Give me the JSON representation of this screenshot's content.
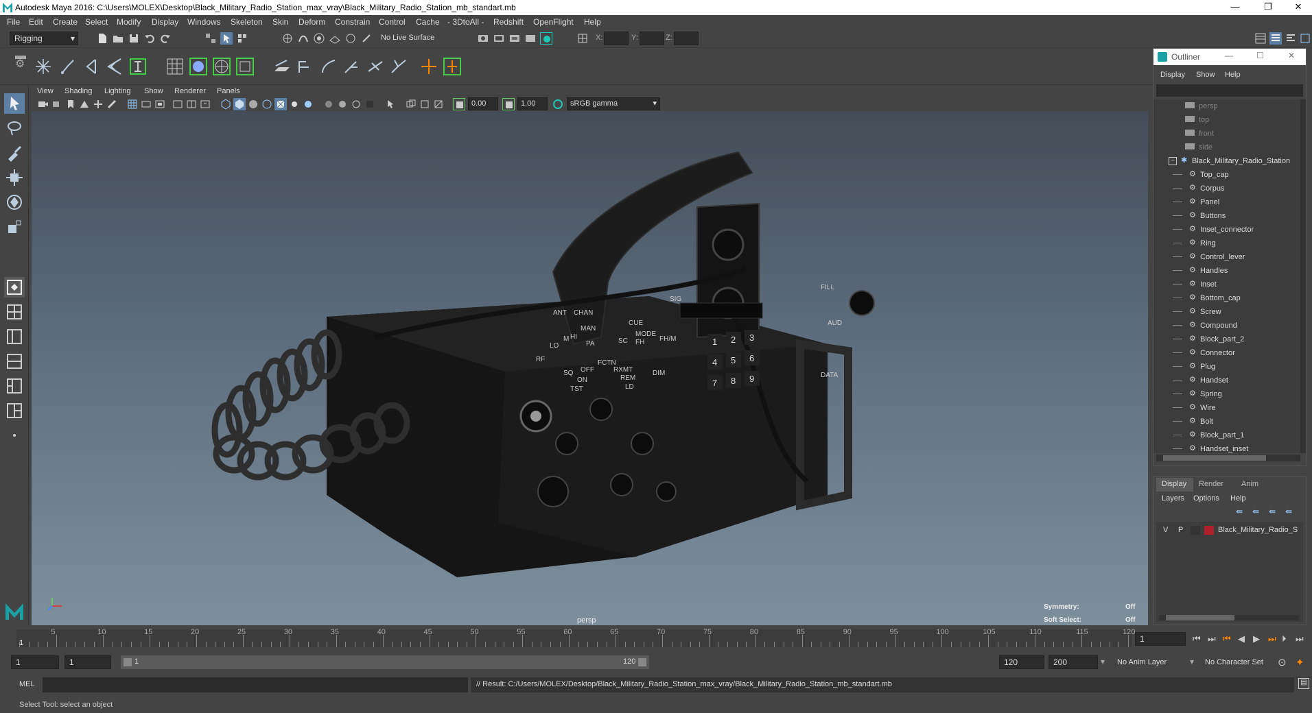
{
  "window": {
    "title": "Autodesk Maya 2016: C:\\Users\\MOLEX\\Desktop\\Black_Military_Radio_Station_max_vray\\Black_Military_Radio_Station_mb_standart.mb",
    "min": "—",
    "restore": "❐",
    "close": "✕"
  },
  "menu": [
    "File",
    "Edit",
    "Create",
    "Select",
    "Modify",
    "Display",
    "Windows",
    "Skeleton",
    "Skin",
    "Deform",
    "Constrain",
    "Control",
    "Cache",
    "- 3DtoAll -",
    "Redshift",
    "OpenFlight",
    "Help"
  ],
  "status": {
    "mode": "Rigging",
    "live_surface": "No Live Surface",
    "x_label": "X:",
    "y_label": "Y:",
    "z_label": "Z:"
  },
  "viewport_menu": [
    "View",
    "Shading",
    "Lighting",
    "Show",
    "Renderer",
    "Panels"
  ],
  "viewport_toolbar": {
    "near": "0.00",
    "far": "1.00",
    "colorspace": "sRGB gamma"
  },
  "viewport": {
    "camera": "persp",
    "symmetry_label": "Symmetry:",
    "symmetry_value": "Off",
    "soft_select_label": "Soft Select:",
    "soft_select_value": "Off"
  },
  "outliner": {
    "title": "Outliner",
    "menu": [
      "Display",
      "Show",
      "Help"
    ],
    "cameras": [
      "persp",
      "top",
      "front",
      "side"
    ],
    "root": "Black_Military_Radio_Station",
    "children": [
      "Top_cap",
      "Corpus",
      "Panel",
      "Buttons",
      "Inset_connector",
      "Ring",
      "Control_lever",
      "Handles",
      "Inset",
      "Bottom_cap",
      "Screw",
      "Compound",
      "Block_part_2",
      "Connector",
      "Plug",
      "Handset",
      "Spring",
      "Wire",
      "Bolt",
      "Block_part_1",
      "Handset_inset"
    ]
  },
  "layer_editor": {
    "tabs": [
      "Display",
      "Render",
      "Anim"
    ],
    "menu": [
      "Layers",
      "Options",
      "Help"
    ],
    "layer": {
      "v": "V",
      "p": "P",
      "name": "Black_Military_Radio_S",
      "color": "#b0202a"
    }
  },
  "timeline": {
    "ticks": [
      "5",
      "10",
      "15",
      "20",
      "25",
      "30",
      "35",
      "40",
      "45",
      "50",
      "55",
      "60",
      "65",
      "70",
      "75",
      "80",
      "85",
      "90",
      "95",
      "100",
      "105",
      "110",
      "115",
      "120"
    ],
    "start_label": "1",
    "current": "1"
  },
  "range": {
    "start": "1",
    "inner_start": "1",
    "slider_start": "1",
    "slider_end": "120",
    "end": "120",
    "max": "200",
    "anim_layer": "No Anim Layer",
    "char_set": "No Character Set"
  },
  "command": {
    "lang": "MEL",
    "result": "// Result: C:/Users/MOLEX/Desktop/Black_Military_Radio_Station_max_vray/Black_Military_Radio_Station_mb_standart.mb"
  },
  "help": "Select Tool: select an object",
  "radio_labels": {
    "ant": "ANT",
    "chan": "CHAN",
    "man": "MAN",
    "cue": "CUE",
    "mode": "MODE",
    "fhm": "FH/M",
    "sc": "SC",
    "fh": "FH",
    "pa": "PA",
    "hi": "HI",
    "lo": "LO",
    "m": "M",
    "rf": "RF",
    "fctn": "FCTN",
    "sq": "SQ",
    "off": "OFF",
    "on": "ON",
    "rxmt": "RXMT",
    "rem": "REM",
    "tst": "TST",
    "ld": "LD",
    "dim": "DIM",
    "sig": "SIG",
    "fill": "FILL",
    "aud": "AUD",
    "data": "DATA",
    "keys": [
      "1",
      "2",
      "3",
      "4",
      "5",
      "6",
      "7",
      "8",
      "9"
    ]
  }
}
